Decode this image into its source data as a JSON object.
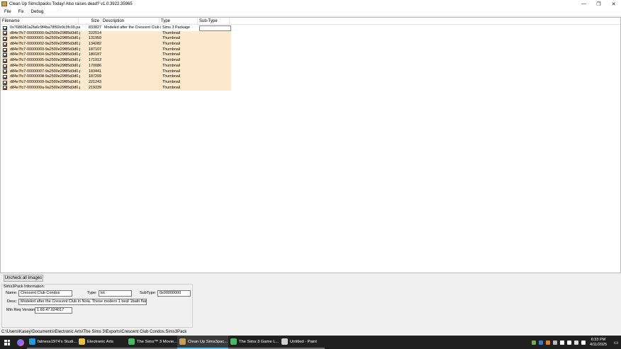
{
  "window": {
    "title": "Clean Up Sims3packs Today! Also raises dead? v1.0.3922.35965",
    "minimize_glyph": "—",
    "restore_glyph": "❐",
    "close_glyph": "✕"
  },
  "menu": {
    "file": "File",
    "fix": "Fix",
    "debug": "Debug"
  },
  "table": {
    "headers": {
      "filename": "Filename",
      "size": "Size",
      "description": "Description",
      "type": "Type",
      "subtype": "Sub-Type"
    },
    "rows": [
      {
        "filename": "0x7686081a2fa6c9f4ba78f92e9c3fc00.pa...",
        "size": "833827",
        "description": "Modeled after the Crescent Club i...",
        "type": "Sims 3 Package",
        "subtype": ""
      },
      {
        "filename": "d84e7fc7-00000000-9a2500e29f85d3d0.png",
        "size": "222514",
        "description": "",
        "type": "Thumbnail",
        "subtype": ""
      },
      {
        "filename": "d84e7fc7-00000001-9a2500e29f85d3d0.png",
        "size": "131959",
        "description": "",
        "type": "Thumbnail",
        "subtype": ""
      },
      {
        "filename": "d84e7fc7-00000002-9a2500e29f85d3d0.png",
        "size": "134282",
        "description": "",
        "type": "Thumbnail",
        "subtype": ""
      },
      {
        "filename": "d84e7fc7-00000003-9a2500e29f85d3d0.png",
        "size": "187107",
        "description": "",
        "type": "Thumbnail",
        "subtype": ""
      },
      {
        "filename": "d84e7fc7-00000004-9a2500e29f85d3d0.png",
        "size": "180187",
        "description": "",
        "type": "Thumbnail",
        "subtype": ""
      },
      {
        "filename": "d84e7fc7-00000005-9a2500e29f85d3d0.png",
        "size": "171912",
        "description": "",
        "type": "Thumbnail",
        "subtype": ""
      },
      {
        "filename": "d84e7fc7-00000006-9a2500e29f85d3d0.png",
        "size": "170086",
        "description": "",
        "type": "Thumbnail",
        "subtype": ""
      },
      {
        "filename": "d84e7fc7-00000007-9a2500e29f85d3d0.png",
        "size": "183441",
        "description": "",
        "type": "Thumbnail",
        "subtype": ""
      },
      {
        "filename": "d84e7fc7-00000008-9a2500e29f85d3d0.png",
        "size": "187209",
        "description": "",
        "type": "Thumbnail",
        "subtype": ""
      },
      {
        "filename": "d84e7fc7-00000009-9a2500e29f85d3d0.png",
        "size": "221243",
        "description": "",
        "type": "Thumbnail",
        "subtype": ""
      },
      {
        "filename": "d84e7fc7-0000000a-9a2500e29f85d3d0.png",
        "size": "219339",
        "description": "",
        "type": "Thumbnail",
        "subtype": ""
      }
    ]
  },
  "uncheck_button": "Uncheck all Images",
  "info": {
    "group_title": "Sims3Pack Information:",
    "name_label": "Name:",
    "name_value": "Crescent Club Condos",
    "type_label": "Type:",
    "type_value": "lot",
    "subtype_label": "SubType:",
    "subtype_value": "0x00000000",
    "desc_label": "Desc:",
    "desc_value": "Modeled after the Crescent Club in Nola.  These modern 1 bed/ 1bath flats are perf",
    "minreq_label": "Min Req Version:",
    "minreq_value": "1.69.47.024017"
  },
  "status": "C:\\Users\\Kasey\\Documents\\Electronic Arts\\The Sims 3\\Exports\\Crescent Club Condos.Sims3Pack",
  "taskbar": {
    "items": [
      {
        "label": "fatness1974's Studi...",
        "icon": "edge-icon",
        "color": "#1b9de2"
      },
      {
        "label": "Electronic Arts",
        "icon": "folder-icon",
        "color": "#f0c03c"
      },
      {
        "label": "The Sims™ 3 Movie...",
        "icon": "sims-icon",
        "color": "#3fbf5f"
      },
      {
        "label": "Clean Up Sims3pac...",
        "icon": "app-icon",
        "color": "#c8a050"
      },
      {
        "label": "The Sims 3 Game L...",
        "icon": "sims-icon",
        "color": "#3fbf5f"
      },
      {
        "label": "Untitled - Paint",
        "icon": "paint-icon",
        "color": "#d0d0d0"
      }
    ],
    "time": "6:33 PM",
    "date": "4/11/2025"
  },
  "colors": {
    "row_highlight": "#fde9cc",
    "taskbar": "#202020",
    "active_accent": "#4cc2ff"
  }
}
